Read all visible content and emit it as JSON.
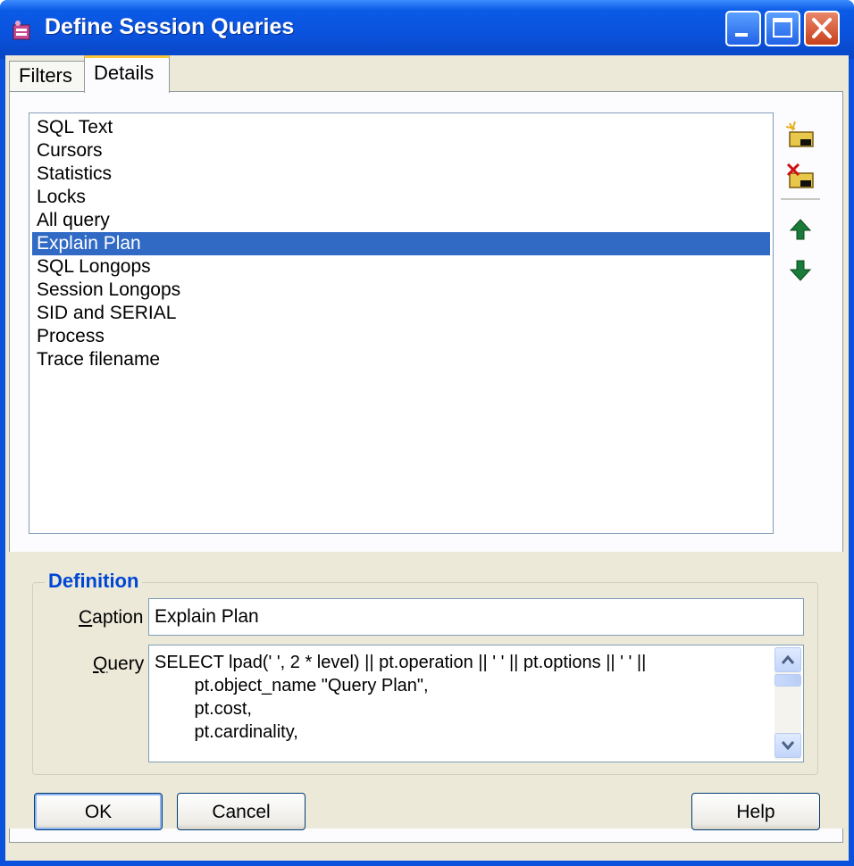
{
  "window": {
    "title": "Define Session Queries"
  },
  "tabs": [
    {
      "label": "Filters",
      "active": false
    },
    {
      "label": "Details",
      "active": true
    }
  ],
  "query_list": {
    "items": [
      "SQL Text",
      "Cursors",
      "Statistics",
      "Locks",
      "All query",
      "Explain Plan",
      "SQL Longops",
      "Session Longops",
      "SID and SERIAL",
      "Process",
      "Trace filename"
    ],
    "selected": "Explain Plan"
  },
  "side_toolbar": [
    "new-item-icon",
    "delete-item-icon",
    "move-up-icon",
    "move-down-icon"
  ],
  "definition": {
    "title": "Definition",
    "caption_label_underlined": "C",
    "caption_label_rest": "aption",
    "caption_value": "Explain Plan",
    "query_label_underlined": "Q",
    "query_label_rest": "uery",
    "query_lines": [
      "SELECT lpad(' ', 2 * level) || pt.operation || ' ' || pt.options || ' ' ||",
      "        pt.object_name \"Query Plan\",",
      "        pt.cost,",
      "        pt.cardinality,"
    ]
  },
  "buttons": {
    "ok": "OK",
    "cancel": "Cancel",
    "help": "Help"
  },
  "colors": {
    "titlebar": "#0a52dc",
    "selection": "#316ac5",
    "group_title": "#0046d5",
    "face": "#ece9d8"
  }
}
